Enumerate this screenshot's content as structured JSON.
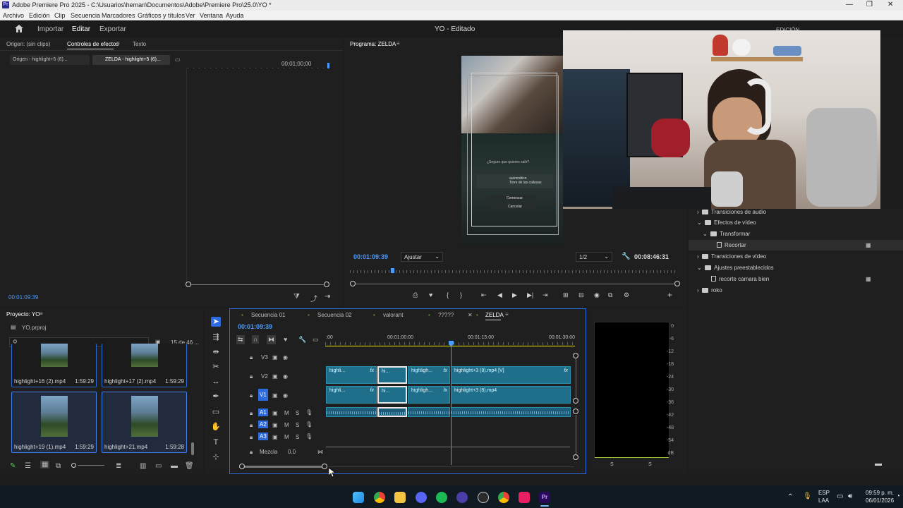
{
  "window": {
    "title": "Adobe Premiere Pro 2025 - C:\\Usuarios\\heman\\Documentos\\Adobe\\Premiere Pro\\25.0\\YO *",
    "app_icon_label": "Pr"
  },
  "menu": [
    "Archivo",
    "Edición",
    "Clip",
    "Secuencia",
    "Marcadores",
    "Gráficos y títulos",
    "Ver",
    "Ventana",
    "Ayuda"
  ],
  "workspace": {
    "tabs": [
      "Importar",
      "Editar",
      "Exportar"
    ],
    "active_tab": "Editar",
    "project_title": "YO - Editado",
    "right_label": "EDICIÓN"
  },
  "source_panel": {
    "tabs": [
      "Origen: (sin clips)",
      "Controles de efectos",
      "Texto"
    ],
    "sub_tabs": [
      "Origen - highlight+5 (6)...",
      "ZELDA - highlight+5 (6)..."
    ],
    "timecode_top": "00;01;00;00",
    "timecode_bottom": "00:01:09:39"
  },
  "program_panel": {
    "title": "Programa: ZELDA",
    "timecode_current": "00:01:09:39",
    "fit_label": "Ajustar",
    "resolution": "1/2",
    "timecode_duration": "00:08:46:31",
    "phone_overlay": {
      "question": "¿Seguro que quieres salir?",
      "item_title": "automático",
      "item_subtitle": "Torre de las callosas",
      "btn_continue": "Comenzar",
      "btn_cancel": "Cancelar"
    }
  },
  "project_panel": {
    "title": "Proyecto: YO",
    "file": "YO.prproj",
    "count": "15 de 46 ...",
    "items": [
      {
        "name": "highlight+16 (2).mp4",
        "duration": "1:59:29"
      },
      {
        "name": "highlight+17 (2).mp4",
        "duration": "1:59:29"
      },
      {
        "name": "highlight+19 (1).mp4",
        "duration": "1:59:29"
      },
      {
        "name": "highlight+21.mp4",
        "duration": "1:59:28"
      }
    ]
  },
  "timeline": {
    "tabs": [
      "Secuencia 01",
      "Secuencia 02",
      "valorant",
      "?????",
      "ZELDA"
    ],
    "active_tab": "ZELDA",
    "timecode": "00:01:09:39",
    "ruler": [
      ":00",
      "00:01:00:00",
      "00:01:15:00",
      "00:01:30:00"
    ],
    "tracks": {
      "v3": "V3",
      "v2": "V2",
      "v1": "V1",
      "a1": "A1",
      "a2": "A2",
      "a3": "A3",
      "mix_label": "Mezcla",
      "mix_value": "0.0",
      "m": "M",
      "s": "S"
    },
    "clips_v2": [
      "highli...",
      "hi...",
      "highligh...",
      "highlight+3 (8).mp4 [V]"
    ],
    "clips_v1": [
      "highli...",
      "hi...",
      "highligh...",
      "highlight+3 (8).mp4"
    ],
    "fx": "fx"
  },
  "meters": [
    "0",
    "-6",
    "-12",
    "-18",
    "-24",
    "-30",
    "-36",
    "-42",
    "-48",
    "-54",
    "dB"
  ],
  "meters_bottom": [
    "S",
    "S"
  ],
  "effects_panel": {
    "rows": [
      {
        "label": "Transiciones de audio",
        "indent": 0,
        "kind": "folder",
        "arrow": "›"
      },
      {
        "label": "Efectos de vídeo",
        "indent": 0,
        "kind": "folder",
        "arrow": "⌄"
      },
      {
        "label": "Transformar",
        "indent": 1,
        "kind": "folder",
        "arrow": "⌄"
      },
      {
        "label": "Recortar",
        "indent": 2,
        "kind": "effect",
        "arrow": ""
      },
      {
        "label": "Transiciones de vídeo",
        "indent": 0,
        "kind": "folder",
        "arrow": "›"
      },
      {
        "label": "Ajustes preestablecidos",
        "indent": 0,
        "kind": "folder",
        "arrow": "⌄"
      },
      {
        "label": "recorte camara bien",
        "indent": 1,
        "kind": "preset",
        "arrow": ""
      },
      {
        "label": "roko",
        "indent": 0,
        "kind": "folder",
        "arrow": "›"
      }
    ]
  },
  "taskbar": {
    "lang": "ESP",
    "lang2": "LAA",
    "time": "09:59 p. m.",
    "date": "06/01/2026"
  },
  "colors": {
    "accent_blue": "#2d8cff",
    "clip_video": "#1f6f8b",
    "playhead": "#4a9cff",
    "work_area": "#e6e600"
  }
}
